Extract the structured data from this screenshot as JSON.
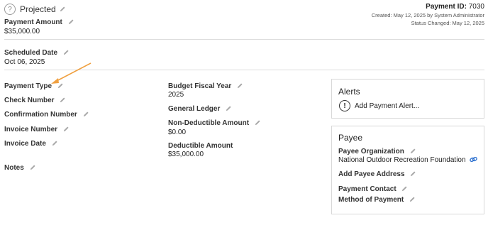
{
  "header": {
    "status_icon_glyph": "?",
    "status": "Projected",
    "payment_id_label": "Payment ID:",
    "payment_id_value": "7030",
    "created": "Created: May 12, 2025 by System Administrator",
    "status_changed": "Status Changed: May 12, 2025"
  },
  "fields": {
    "payment_amount_label": "Payment Amount",
    "payment_amount_value": "$35,000.00",
    "scheduled_date_label": "Scheduled Date",
    "scheduled_date_value": "Oct 06, 2025",
    "payment_type_label": "Payment Type",
    "check_number_label": "Check Number",
    "confirmation_number_label": "Confirmation Number",
    "invoice_number_label": "Invoice Number",
    "invoice_date_label": "Invoice Date",
    "notes_label": "Notes",
    "budget_fiscal_year_label": "Budget Fiscal Year",
    "budget_fiscal_year_value": "2025",
    "general_ledger_label": "General Ledger",
    "non_deductible_amount_label": "Non-Deductible Amount",
    "non_deductible_amount_value": "$0.00",
    "deductible_amount_label": "Deductible Amount",
    "deductible_amount_value": "$35,000.00"
  },
  "alerts": {
    "title": "Alerts",
    "icon_glyph": "!",
    "add_label": "Add Payment Alert..."
  },
  "payee": {
    "title": "Payee",
    "organization_label": "Payee Organization",
    "organization_value": "National Outdoor Recreation Foundation",
    "add_address_label": "Add Payee Address",
    "contact_label": "Payment Contact",
    "method_label": "Method of Payment"
  },
  "colors": {
    "annotation_arrow": "#f0a040",
    "link_icon": "#2a6fcf",
    "divider": "#dcdcdc"
  },
  "icons": {
    "edit": "pencil-icon",
    "status": "question-circle-icon",
    "alert": "exclamation-circle-icon",
    "link": "link-icon",
    "annotation": "arrow-annotation"
  }
}
